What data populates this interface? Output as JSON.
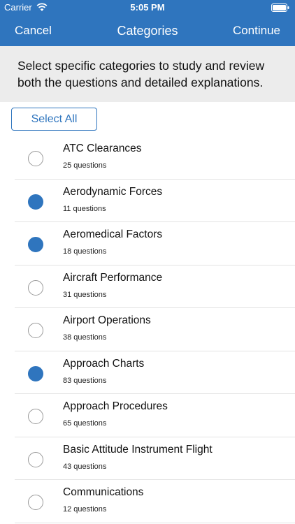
{
  "status_bar": {
    "carrier": "Carrier",
    "time": "5:05 PM",
    "wifi_icon": "wifi-icon",
    "battery_icon": "battery-icon"
  },
  "nav": {
    "cancel_label": "Cancel",
    "title": "Categories",
    "continue_label": "Continue"
  },
  "instructions": "Select specific categories to study and review both the questions and detailed explanations.",
  "select_all_label": "Select All",
  "colors": {
    "accent": "#2f75be",
    "banner": "#ececec"
  },
  "categories": [
    {
      "title": "ATC Clearances",
      "count": "25 questions",
      "selected": false
    },
    {
      "title": "Aerodynamic Forces",
      "count": "11 questions",
      "selected": true
    },
    {
      "title": "Aeromedical Factors",
      "count": "18 questions",
      "selected": true
    },
    {
      "title": "Aircraft Performance",
      "count": "31 questions",
      "selected": false
    },
    {
      "title": "Airport Operations",
      "count": "38 questions",
      "selected": false
    },
    {
      "title": "Approach Charts",
      "count": "83 questions",
      "selected": true
    },
    {
      "title": "Approach Procedures",
      "count": "65 questions",
      "selected": false
    },
    {
      "title": "Basic Attitude Instrument Flight",
      "count": "43 questions",
      "selected": false
    },
    {
      "title": "Communications",
      "count": "12 questions",
      "selected": false
    }
  ]
}
